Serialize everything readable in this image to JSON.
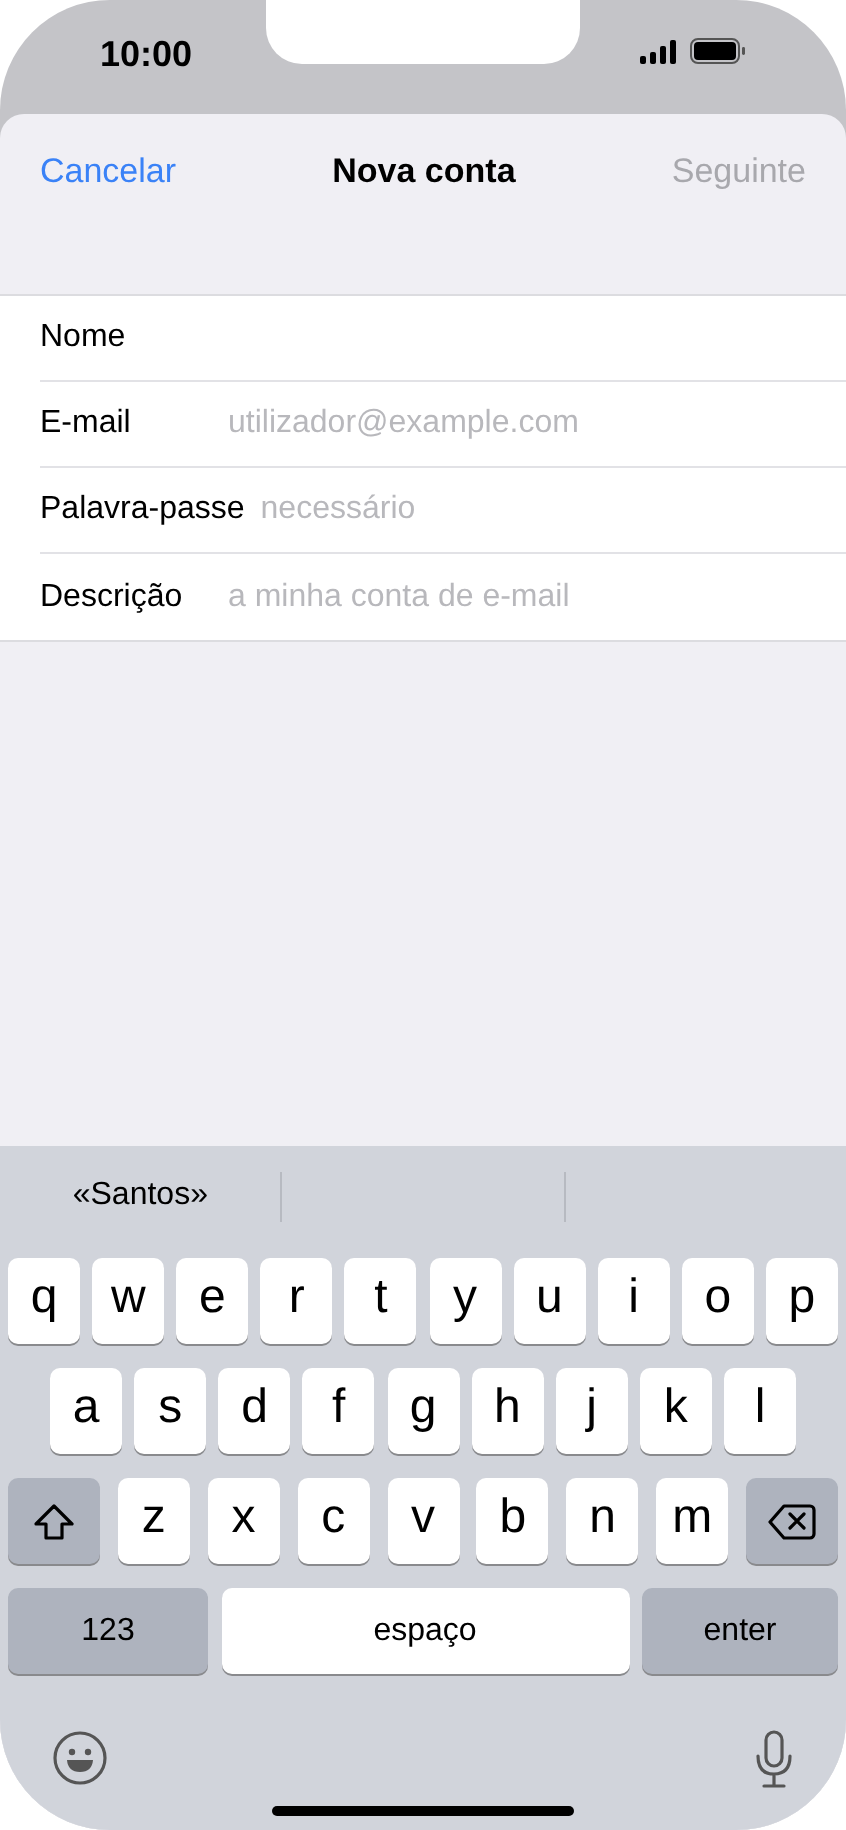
{
  "status_bar": {
    "time": "10:00"
  },
  "nav": {
    "cancel": "Cancelar",
    "title": "Nova conta",
    "next": {
      "label": "Seguinte",
      "disabled": true
    }
  },
  "fields": [
    {
      "label": "Nome"
    },
    {
      "label": "E-mail",
      "placeholder": "utilizador@example.com"
    },
    {
      "label": "Palavra-passe",
      "placeholder": "necessário"
    },
    {
      "label": "Descrição",
      "placeholder": "a minha conta de e-mail"
    }
  ],
  "keyboard": {
    "suggestions": [
      "«Santos»"
    ],
    "rows": [
      {
        "keys": [
          {
            "kind": "letter",
            "label": "q"
          },
          {
            "kind": "letter",
            "label": "w"
          },
          {
            "kind": "letter",
            "label": "e"
          },
          {
            "kind": "letter",
            "label": "r"
          },
          {
            "kind": "letter",
            "label": "t"
          },
          {
            "kind": "letter",
            "label": "y"
          },
          {
            "kind": "letter",
            "label": "u"
          },
          {
            "kind": "letter",
            "label": "i"
          },
          {
            "kind": "letter",
            "label": "o"
          },
          {
            "kind": "letter",
            "label": "p"
          }
        ]
      },
      {
        "keys": [
          {
            "kind": "letter",
            "label": "a"
          },
          {
            "kind": "letter",
            "label": "s"
          },
          {
            "kind": "letter",
            "label": "d"
          },
          {
            "kind": "letter",
            "label": "f"
          },
          {
            "kind": "letter",
            "label": "g"
          },
          {
            "kind": "letter",
            "label": "h"
          },
          {
            "kind": "letter",
            "label": "j"
          },
          {
            "kind": "letter",
            "label": "k"
          },
          {
            "kind": "letter",
            "label": "l"
          }
        ]
      },
      {
        "keys": [
          {
            "kind": "shift"
          },
          {
            "kind": "letter",
            "label": "z"
          },
          {
            "kind": "letter",
            "label": "x"
          },
          {
            "kind": "letter",
            "label": "c"
          },
          {
            "kind": "letter",
            "label": "v"
          },
          {
            "kind": "letter",
            "label": "b"
          },
          {
            "kind": "letter",
            "label": "n"
          },
          {
            "kind": "letter",
            "label": "m"
          },
          {
            "kind": "backspace"
          }
        ]
      },
      {
        "keys": [
          {
            "kind": "numbers",
            "label": "123"
          },
          {
            "kind": "space",
            "label": "espaço"
          },
          {
            "kind": "return",
            "label": "enter"
          }
        ]
      }
    ]
  }
}
